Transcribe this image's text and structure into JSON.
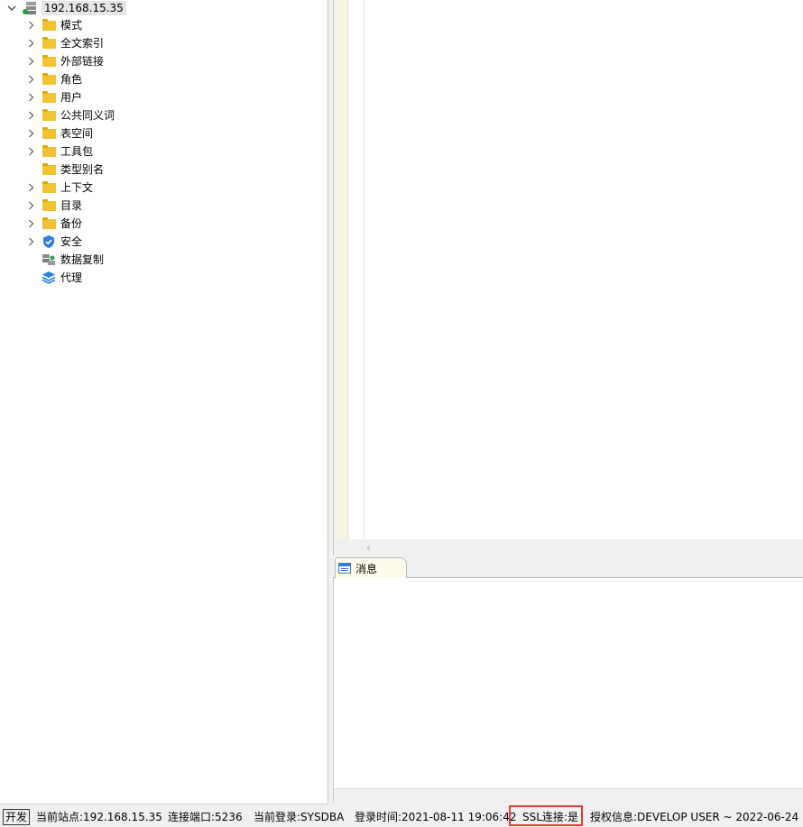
{
  "tree": {
    "root": {
      "label": "192.168.15.35",
      "expanded": true,
      "icon": "server-icon"
    },
    "items": [
      {
        "label": "模式",
        "icon": "folder-icon",
        "expandable": true
      },
      {
        "label": "全文索引",
        "icon": "folder-icon",
        "expandable": true
      },
      {
        "label": "外部链接",
        "icon": "folder-icon",
        "expandable": true
      },
      {
        "label": "角色",
        "icon": "folder-icon",
        "expandable": true
      },
      {
        "label": "用户",
        "icon": "folder-icon",
        "expandable": true
      },
      {
        "label": "公共同义词",
        "icon": "folder-icon",
        "expandable": true
      },
      {
        "label": "表空间",
        "icon": "folder-icon",
        "expandable": true
      },
      {
        "label": "工具包",
        "icon": "folder-icon",
        "expandable": true
      },
      {
        "label": "类型别名",
        "icon": "folder-icon",
        "expandable": false
      },
      {
        "label": "上下文",
        "icon": "folder-icon",
        "expandable": true
      },
      {
        "label": "目录",
        "icon": "folder-icon",
        "expandable": true
      },
      {
        "label": "备份",
        "icon": "folder-icon",
        "expandable": true
      },
      {
        "label": "安全",
        "icon": "shield-icon",
        "expandable": true
      },
      {
        "label": "数据复制",
        "icon": "replication-icon",
        "expandable": false
      },
      {
        "label": "代理",
        "icon": "layers-icon",
        "expandable": false
      }
    ]
  },
  "messages_tab": {
    "label": "消息"
  },
  "statusbar": {
    "mode": "开发",
    "site": "当前站点:192.168.15.35",
    "port": "连接端口:5236",
    "login": "当前登录:SYSDBA",
    "login_time": "登录时间:2021-08-11 19:06:42",
    "ssl": "SSL连接:是",
    "license": "授权信息:DEVELOP USER ~ 2022-06-24"
  },
  "colors": {
    "folder": "#f1c232",
    "shield": "#2b7de0",
    "highlight_box": "#e53935",
    "gutter": "#f7f4e6"
  }
}
